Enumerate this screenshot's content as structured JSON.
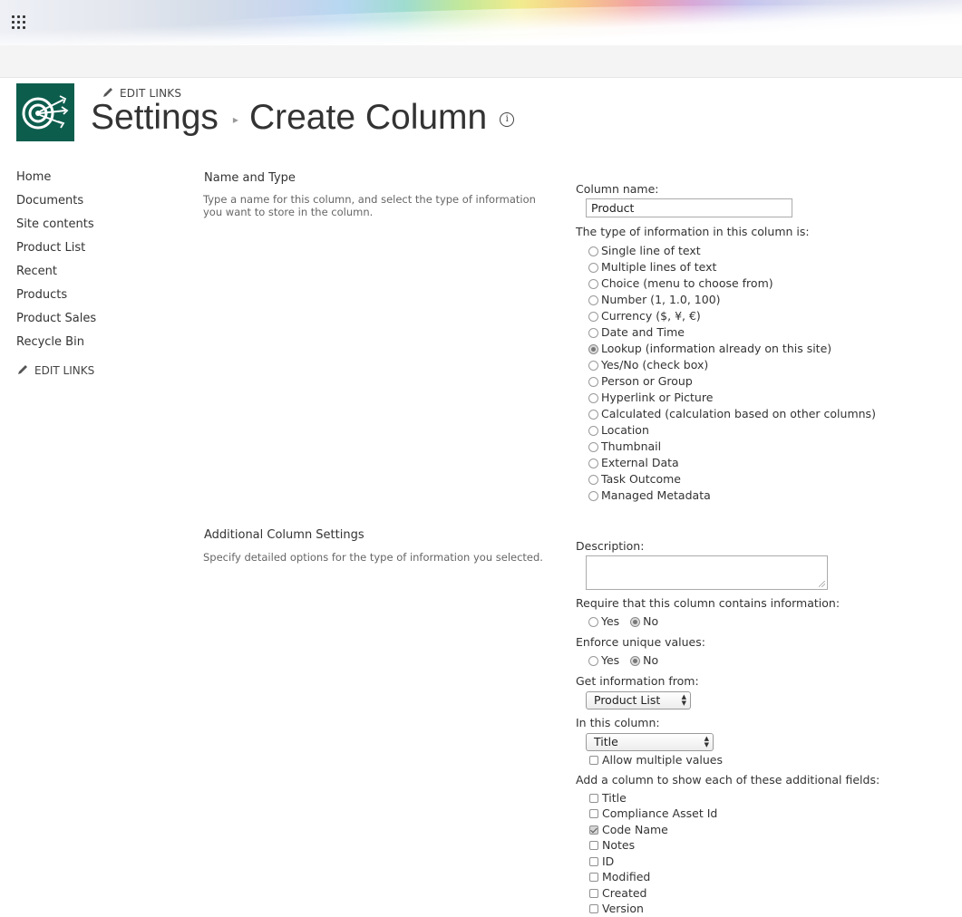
{
  "header": {
    "edit_links": "EDIT LINKS",
    "breadcrumb_parent": "Settings",
    "breadcrumb_separator": "▸",
    "page_title": "Create Column",
    "info_glyph": "i"
  },
  "nav": {
    "items": [
      {
        "label": "Home"
      },
      {
        "label": "Documents"
      },
      {
        "label": "Site contents"
      },
      {
        "label": "Product List"
      },
      {
        "label": "Recent"
      },
      {
        "label": "Products"
      },
      {
        "label": "Product Sales"
      },
      {
        "label": "Recycle Bin"
      }
    ],
    "edit_links": "EDIT LINKS"
  },
  "name_type": {
    "title": "Name and Type",
    "description": "Type a name for this column, and select the type of information you want to store in the column.",
    "column_name_label": "Column name:",
    "column_name_value": "Product",
    "type_label": "The type of information in this column is:",
    "selected_type": "Lookup (information already on this site)",
    "types": [
      {
        "label": "Single line of text",
        "checked": false
      },
      {
        "label": "Multiple lines of text",
        "checked": false
      },
      {
        "label": "Choice (menu to choose from)",
        "checked": false
      },
      {
        "label": "Number (1, 1.0, 100)",
        "checked": false
      },
      {
        "label": "Currency ($, ¥, €)",
        "checked": false
      },
      {
        "label": "Date and Time",
        "checked": false
      },
      {
        "label": "Lookup (information already on this site)",
        "checked": true
      },
      {
        "label": "Yes/No (check box)",
        "checked": false
      },
      {
        "label": "Person or Group",
        "checked": false
      },
      {
        "label": "Hyperlink or Picture",
        "checked": false
      },
      {
        "label": "Calculated (calculation based on other columns)",
        "checked": false
      },
      {
        "label": "Location",
        "checked": false
      },
      {
        "label": "Thumbnail",
        "checked": false
      },
      {
        "label": "External Data",
        "checked": false
      },
      {
        "label": "Task Outcome",
        "checked": false
      },
      {
        "label": "Managed Metadata",
        "checked": false
      }
    ]
  },
  "additional": {
    "title": "Additional Column Settings",
    "description": "Specify detailed options for the type of information you selected.",
    "description_label": "Description:",
    "description_value": "",
    "require_label": "Require that this column contains information:",
    "require_yes": "Yes",
    "require_no": "No",
    "require_value": "No",
    "unique_label": "Enforce unique values:",
    "unique_yes": "Yes",
    "unique_no": "No",
    "unique_value": "No",
    "get_info_label": "Get information from:",
    "get_info_value": "Product List",
    "in_column_label": "In this column:",
    "in_column_value": "Title",
    "allow_multiple_label": "Allow multiple values",
    "allow_multiple_checked": false,
    "additional_fields_label": "Add a column to show each of these additional fields:",
    "fields": [
      {
        "label": "Title",
        "checked": false
      },
      {
        "label": "Compliance Asset Id",
        "checked": false
      },
      {
        "label": "Code Name",
        "checked": true
      },
      {
        "label": "Notes",
        "checked": false
      },
      {
        "label": "ID",
        "checked": false
      },
      {
        "label": "Modified",
        "checked": false
      },
      {
        "label": "Created",
        "checked": false
      },
      {
        "label": "Version",
        "checked": false
      }
    ]
  },
  "colors": {
    "logo_bg": "#0d5d4d",
    "text": "#333333",
    "subbar_bg": "#f4f4f4"
  },
  "icons": {
    "app_launcher": "waffle-icon",
    "edit": "pencil-icon",
    "info": "info-icon",
    "logo": "target-arrows-logo"
  }
}
